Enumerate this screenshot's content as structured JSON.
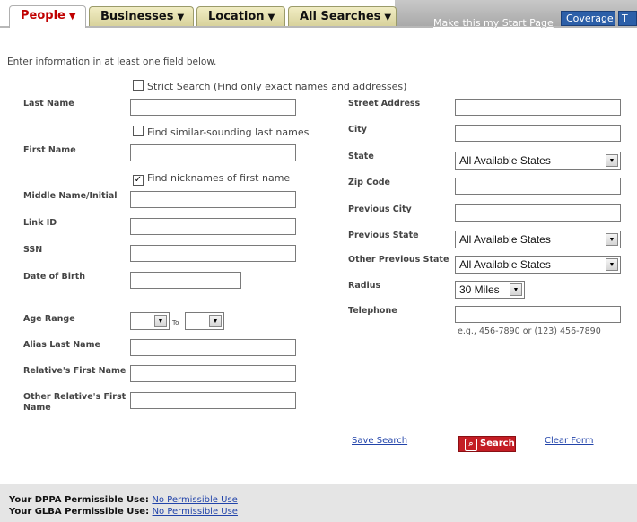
{
  "tabs": [
    {
      "label": "People",
      "arrow": "▼"
    },
    {
      "label": "Businesses",
      "arrow": "▼"
    },
    {
      "label": "Location",
      "arrow": "▼"
    },
    {
      "label": "All Searches",
      "arrow": "▼"
    }
  ],
  "header": {
    "start_page": "Make this my Start Page",
    "coverage": "Coverage",
    "extra_tab": "T"
  },
  "instructions": "Enter information in at least one field below.",
  "checkboxes": {
    "strict": {
      "label": "Strict Search (Find only exact names and addresses)",
      "checked": false
    },
    "similar": {
      "label": "Find similar-sounding last names",
      "checked": false
    },
    "nicknames": {
      "label": "Find nicknames of first name",
      "checked": true
    }
  },
  "left_fields": {
    "last_name": "Last Name",
    "first_name": "First Name",
    "middle_name": "Middle Name/Initial",
    "link_id": "Link ID",
    "ssn": "SSN",
    "dob": "Date of Birth",
    "age_range": "Age Range",
    "age_to": "To",
    "alias_last": "Alias Last Name",
    "relative_first": "Relative's First Name",
    "other_relative_first": "Other Relative's First Name"
  },
  "right_fields": {
    "street": "Street Address",
    "city": "City",
    "state": "State",
    "state_value": "All Available States",
    "zip": "Zip Code",
    "prev_city": "Previous City",
    "prev_state": "Previous State",
    "prev_state_value": "All Available States",
    "other_prev_state": "Other Previous State",
    "other_prev_state_value": "All Available States",
    "radius": "Radius",
    "radius_value": "30 Miles",
    "telephone": "Telephone",
    "telephone_hint": "e.g., 456-7890 or (123) 456-7890"
  },
  "actions": {
    "save": "Save Search",
    "search": "Search",
    "clear": "Clear Form"
  },
  "footer": {
    "dppa_label": "Your DPPA Permissible Use:",
    "dppa_value": "No Permissible Use",
    "glba_label": "Your GLBA Permissible Use:",
    "glba_value": "No Permissible Use"
  }
}
